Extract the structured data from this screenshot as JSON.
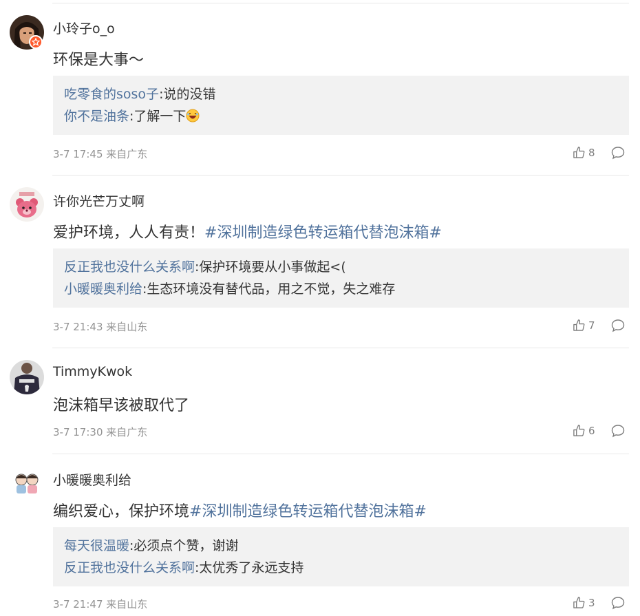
{
  "comments": [
    {
      "username": "小玲子o_o",
      "verified": true,
      "text": "环保是大事～",
      "topic": "",
      "replies": [
        {
          "user": "吃零食的soso子",
          "text": ":说的没错"
        },
        {
          "user": "你不是油条",
          "text": ":了解一下"
        }
      ],
      "time": "3-7 17:45 来自广东",
      "likes": "8"
    },
    {
      "username": "许你光芒万丈啊",
      "verified": false,
      "text": "爱护环境，人人有责！",
      "topic": "#深圳制造绿色转运箱代替泡沫箱#",
      "replies": [
        {
          "user": "反正我也没什么关系啊",
          "text": ":保护环境要从小事做起<("
        },
        {
          "user": "小暖暖奥利给",
          "text": ":生态环境没有替代品，用之不觉，失之难存"
        }
      ],
      "time": "3-7 21:43 来自山东",
      "likes": "7"
    },
    {
      "username": "TimmyKwok",
      "verified": false,
      "text": "泡沫箱早该被取代了",
      "topic": "",
      "replies": [],
      "time": "3-7 17:30 来自广东",
      "likes": "6"
    },
    {
      "username": "小暖暖奥利给",
      "verified": false,
      "text": "编织爱心，保护环境",
      "topic": "#深圳制造绿色转运箱代替泡沫箱#",
      "replies": [
        {
          "user": "每天很温暖",
          "text": ":必须点个赞，谢谢"
        },
        {
          "user": "反正我也没什么关系啊",
          "text": ":太优秀了永远支持"
        }
      ],
      "time": "3-7 21:47 来自山东",
      "likes": "3"
    }
  ],
  "colors": {
    "link": "#50729c",
    "meta": "#939393",
    "reply_bg": "#f2f2f2",
    "badge": "#ff5a2c"
  },
  "icons": [
    "verified-badge-icon",
    "laughing-emoji-icon",
    "thumbs-up-icon",
    "comment-bubble-icon"
  ]
}
